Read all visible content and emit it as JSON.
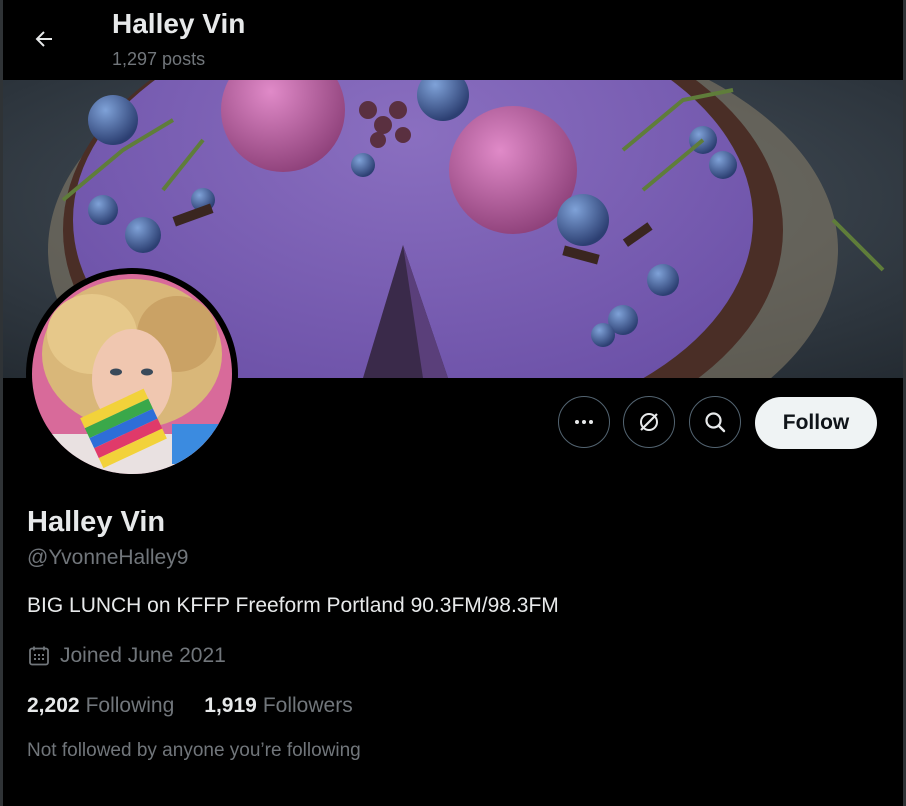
{
  "header": {
    "title": "Halley Vin",
    "posts_count": "1,297 posts"
  },
  "profile": {
    "display_name": "Halley Vin",
    "handle": "@YvonneHalley9",
    "bio": "BIG LUNCH on KFFP Freeform Portland 90.3FM/98.3FM",
    "joined": "Joined June 2021",
    "following_count": "2,202",
    "following_label": "Following",
    "followers_count": "1,919",
    "followers_label": "Followers",
    "not_followed_text": "Not followed by anyone you’re following"
  },
  "actions": {
    "follow_label": "Follow",
    "more_icon": "more-icon",
    "grok_icon": "grok-icon",
    "search_icon": "search-icon"
  },
  "colors": {
    "background": "#000000",
    "primary_text": "#e7e9ea",
    "secondary_text": "#71767b",
    "button_border": "#536471",
    "follow_bg": "#eff3f4"
  }
}
